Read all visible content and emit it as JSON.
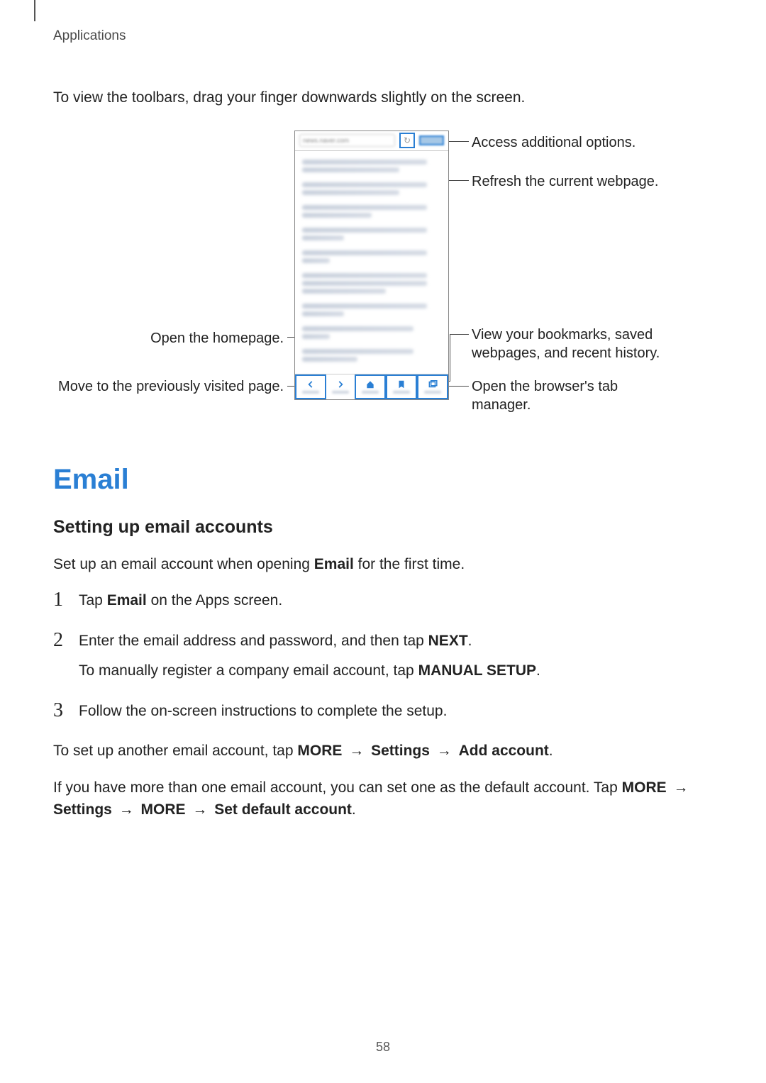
{
  "header": "Applications",
  "intro_para": "To view the toolbars, drag your finger downwards slightly on the screen.",
  "diagram": {
    "left": {
      "open_homepage": "Open the homepage.",
      "move_prev": "Move to the previously visited page."
    },
    "right": {
      "access_options": "Access additional options.",
      "refresh": "Refresh the current webpage.",
      "bookmarks": "View your bookmarks, saved webpages, and recent history.",
      "tab_manager": "Open the browser's tab manager."
    }
  },
  "section_title": "Email",
  "subsection_title": "Setting up email accounts",
  "setup_intro_a": "Set up an email account when opening ",
  "setup_intro_b": "Email",
  "setup_intro_c": " for the first time.",
  "steps": {
    "1": {
      "a": "Tap ",
      "b": "Email",
      "c": " on the Apps screen."
    },
    "2": {
      "a": "Enter the email address and password, and then tap ",
      "b": "NEXT",
      "c": ".",
      "d": "To manually register a company email account, tap ",
      "e": "MANUAL SETUP",
      "f": "."
    },
    "3": {
      "a": "Follow the on-screen instructions to complete the setup."
    }
  },
  "another": {
    "a": "To set up another email account, tap ",
    "b": "MORE",
    "c": "Settings",
    "d": "Add account",
    "e": "."
  },
  "default": {
    "a": "If you have more than one email account, you can set one as the default account. Tap ",
    "b": "MORE",
    "c": "Settings",
    "d": "MORE",
    "e": "Set default account",
    "f": "."
  },
  "arrow_glyph": "→",
  "page_number": "58"
}
